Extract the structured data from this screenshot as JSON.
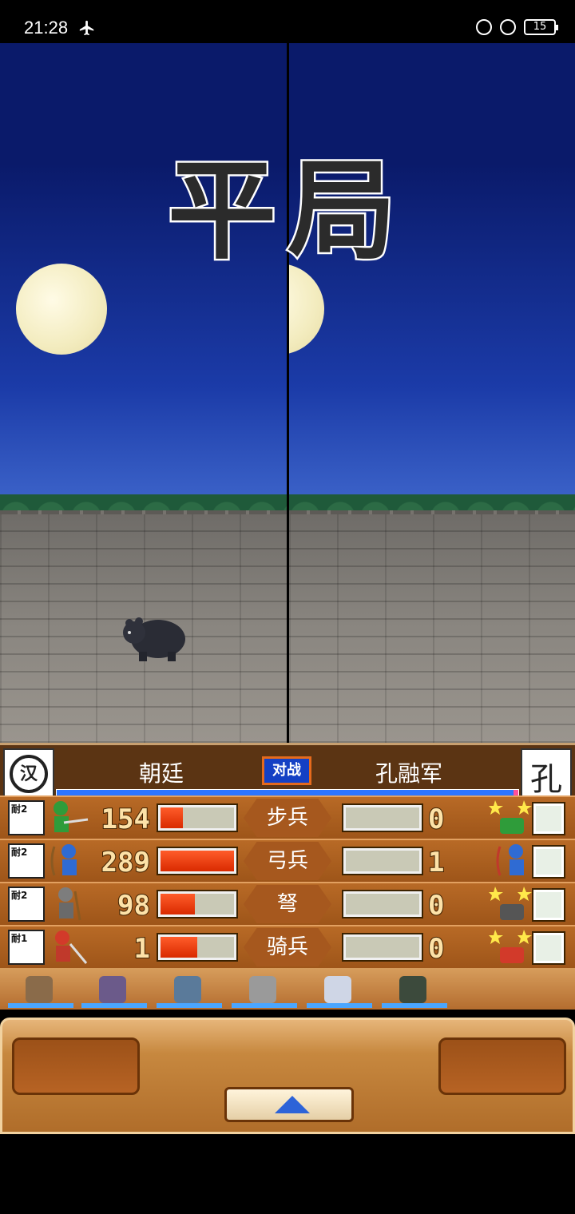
{
  "status_bar": {
    "time": "21:28",
    "battery": "15"
  },
  "battle": {
    "result": "平局",
    "left_side": "朝廷",
    "right_side": "孔融军",
    "vs_label": "对战",
    "left_emblem": "汉",
    "right_emblem": "孔"
  },
  "rows": [
    {
      "type": "步兵",
      "left_count": "154",
      "right_count": "0",
      "left_fill": 0.3,
      "right_fill": 0,
      "badge": "耐2"
    },
    {
      "type": "弓兵",
      "left_count": "289",
      "right_count": "1",
      "left_fill": 1.0,
      "right_fill": 0,
      "badge": "耐2"
    },
    {
      "type": "弩",
      "left_count": "98",
      "right_count": "0",
      "left_fill": 0.47,
      "right_fill": 0,
      "badge": "耐2"
    },
    {
      "type": "骑兵",
      "left_count": "1",
      "right_count": "0",
      "left_fill": 0.5,
      "right_fill": 0,
      "badge": "耐1"
    }
  ],
  "colors": {
    "sky": "#0a1a6a",
    "panel": "#5b3413",
    "gauge_fill": "#d92a00",
    "hp_bar": "#2d75ff"
  }
}
